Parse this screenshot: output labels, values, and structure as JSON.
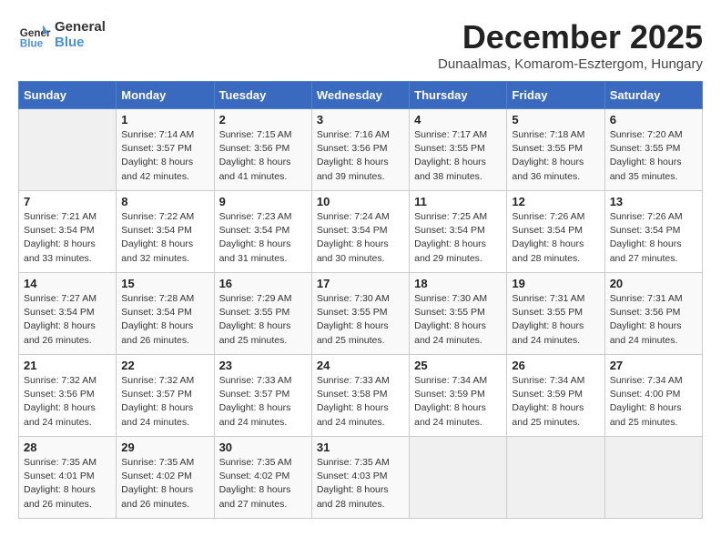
{
  "header": {
    "logo_line1": "General",
    "logo_line2": "Blue",
    "month_title": "December 2025",
    "subtitle": "Dunaalmas, Komarom-Esztergom, Hungary"
  },
  "days_of_week": [
    "Sunday",
    "Monday",
    "Tuesday",
    "Wednesday",
    "Thursday",
    "Friday",
    "Saturday"
  ],
  "weeks": [
    [
      {
        "day": "",
        "info": ""
      },
      {
        "day": "1",
        "info": "Sunrise: 7:14 AM\nSunset: 3:57 PM\nDaylight: 8 hours\nand 42 minutes."
      },
      {
        "day": "2",
        "info": "Sunrise: 7:15 AM\nSunset: 3:56 PM\nDaylight: 8 hours\nand 41 minutes."
      },
      {
        "day": "3",
        "info": "Sunrise: 7:16 AM\nSunset: 3:56 PM\nDaylight: 8 hours\nand 39 minutes."
      },
      {
        "day": "4",
        "info": "Sunrise: 7:17 AM\nSunset: 3:55 PM\nDaylight: 8 hours\nand 38 minutes."
      },
      {
        "day": "5",
        "info": "Sunrise: 7:18 AM\nSunset: 3:55 PM\nDaylight: 8 hours\nand 36 minutes."
      },
      {
        "day": "6",
        "info": "Sunrise: 7:20 AM\nSunset: 3:55 PM\nDaylight: 8 hours\nand 35 minutes."
      }
    ],
    [
      {
        "day": "7",
        "info": "Sunrise: 7:21 AM\nSunset: 3:54 PM\nDaylight: 8 hours\nand 33 minutes."
      },
      {
        "day": "8",
        "info": "Sunrise: 7:22 AM\nSunset: 3:54 PM\nDaylight: 8 hours\nand 32 minutes."
      },
      {
        "day": "9",
        "info": "Sunrise: 7:23 AM\nSunset: 3:54 PM\nDaylight: 8 hours\nand 31 minutes."
      },
      {
        "day": "10",
        "info": "Sunrise: 7:24 AM\nSunset: 3:54 PM\nDaylight: 8 hours\nand 30 minutes."
      },
      {
        "day": "11",
        "info": "Sunrise: 7:25 AM\nSunset: 3:54 PM\nDaylight: 8 hours\nand 29 minutes."
      },
      {
        "day": "12",
        "info": "Sunrise: 7:26 AM\nSunset: 3:54 PM\nDaylight: 8 hours\nand 28 minutes."
      },
      {
        "day": "13",
        "info": "Sunrise: 7:26 AM\nSunset: 3:54 PM\nDaylight: 8 hours\nand 27 minutes."
      }
    ],
    [
      {
        "day": "14",
        "info": "Sunrise: 7:27 AM\nSunset: 3:54 PM\nDaylight: 8 hours\nand 26 minutes."
      },
      {
        "day": "15",
        "info": "Sunrise: 7:28 AM\nSunset: 3:54 PM\nDaylight: 8 hours\nand 26 minutes."
      },
      {
        "day": "16",
        "info": "Sunrise: 7:29 AM\nSunset: 3:55 PM\nDaylight: 8 hours\nand 25 minutes."
      },
      {
        "day": "17",
        "info": "Sunrise: 7:30 AM\nSunset: 3:55 PM\nDaylight: 8 hours\nand 25 minutes."
      },
      {
        "day": "18",
        "info": "Sunrise: 7:30 AM\nSunset: 3:55 PM\nDaylight: 8 hours\nand 24 minutes."
      },
      {
        "day": "19",
        "info": "Sunrise: 7:31 AM\nSunset: 3:55 PM\nDaylight: 8 hours\nand 24 minutes."
      },
      {
        "day": "20",
        "info": "Sunrise: 7:31 AM\nSunset: 3:56 PM\nDaylight: 8 hours\nand 24 minutes."
      }
    ],
    [
      {
        "day": "21",
        "info": "Sunrise: 7:32 AM\nSunset: 3:56 PM\nDaylight: 8 hours\nand 24 minutes."
      },
      {
        "day": "22",
        "info": "Sunrise: 7:32 AM\nSunset: 3:57 PM\nDaylight: 8 hours\nand 24 minutes."
      },
      {
        "day": "23",
        "info": "Sunrise: 7:33 AM\nSunset: 3:57 PM\nDaylight: 8 hours\nand 24 minutes."
      },
      {
        "day": "24",
        "info": "Sunrise: 7:33 AM\nSunset: 3:58 PM\nDaylight: 8 hours\nand 24 minutes."
      },
      {
        "day": "25",
        "info": "Sunrise: 7:34 AM\nSunset: 3:59 PM\nDaylight: 8 hours\nand 24 minutes."
      },
      {
        "day": "26",
        "info": "Sunrise: 7:34 AM\nSunset: 3:59 PM\nDaylight: 8 hours\nand 25 minutes."
      },
      {
        "day": "27",
        "info": "Sunrise: 7:34 AM\nSunset: 4:00 PM\nDaylight: 8 hours\nand 25 minutes."
      }
    ],
    [
      {
        "day": "28",
        "info": "Sunrise: 7:35 AM\nSunset: 4:01 PM\nDaylight: 8 hours\nand 26 minutes."
      },
      {
        "day": "29",
        "info": "Sunrise: 7:35 AM\nSunset: 4:02 PM\nDaylight: 8 hours\nand 26 minutes."
      },
      {
        "day": "30",
        "info": "Sunrise: 7:35 AM\nSunset: 4:02 PM\nDaylight: 8 hours\nand 27 minutes."
      },
      {
        "day": "31",
        "info": "Sunrise: 7:35 AM\nSunset: 4:03 PM\nDaylight: 8 hours\nand 28 minutes."
      },
      {
        "day": "",
        "info": ""
      },
      {
        "day": "",
        "info": ""
      },
      {
        "day": "",
        "info": ""
      }
    ]
  ]
}
